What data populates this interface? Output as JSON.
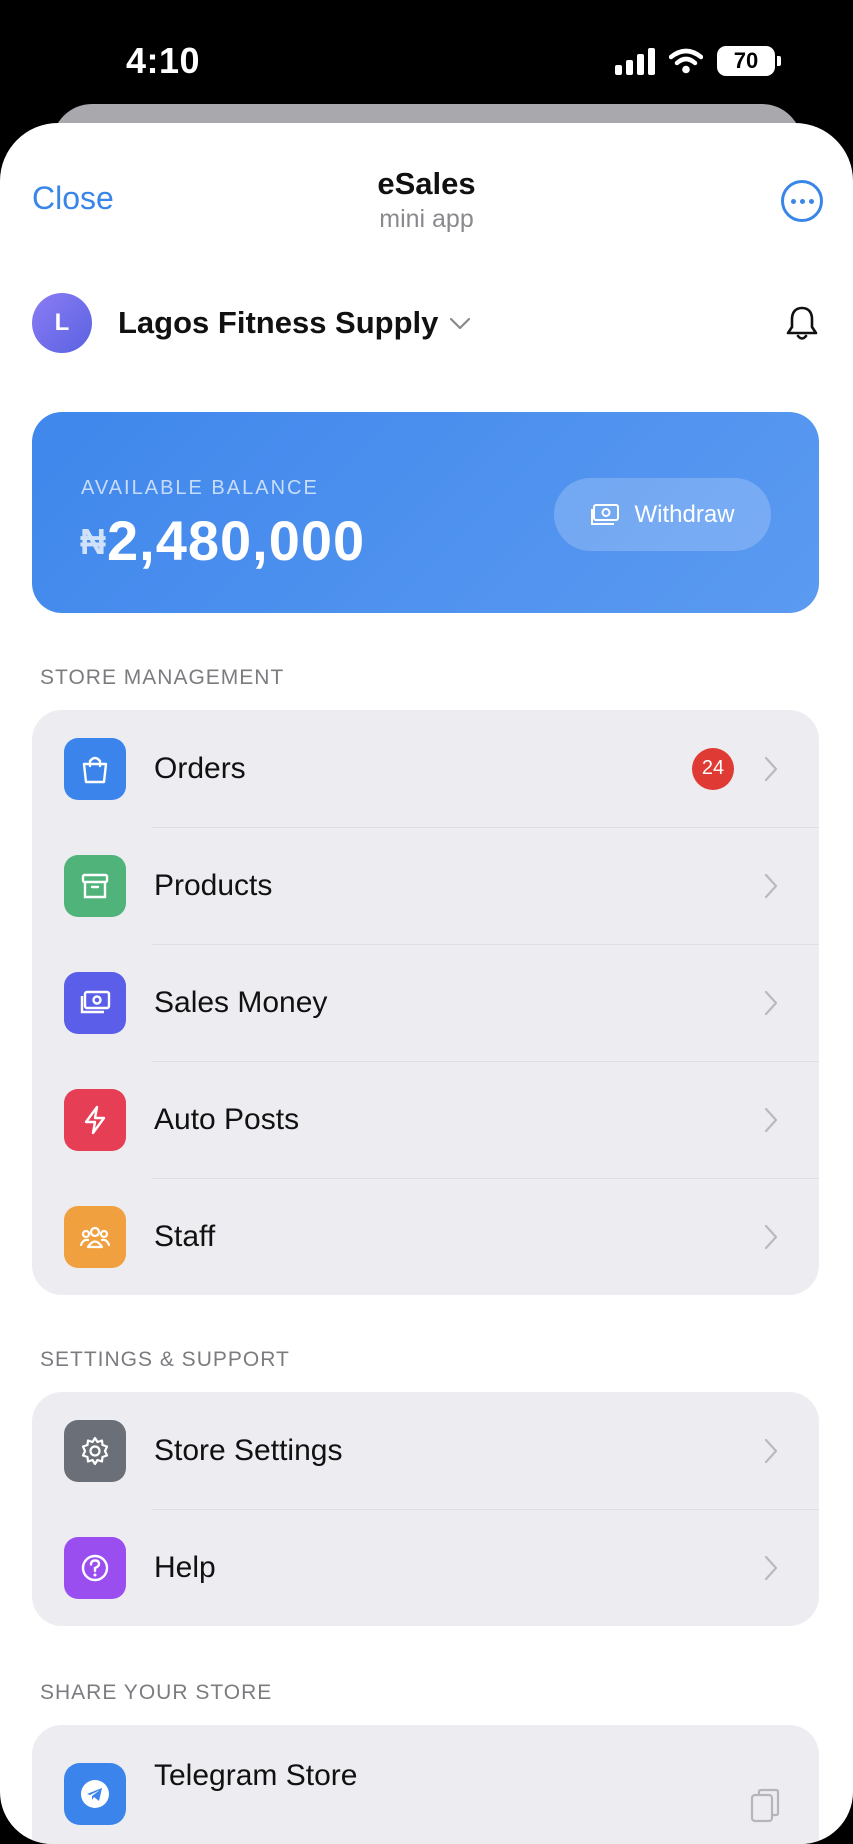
{
  "status_bar": {
    "time": "4:10",
    "battery": "70"
  },
  "header": {
    "close_label": "Close",
    "title": "eSales",
    "subtitle": "mini app"
  },
  "store": {
    "avatar_initial": "L",
    "name": "Lagos Fitness Supply"
  },
  "balance": {
    "label": "AVAILABLE BALANCE",
    "currency": "₦",
    "amount": "2,480,000",
    "withdraw_label": "Withdraw"
  },
  "sections": {
    "store_management": {
      "title": "STORE MANAGEMENT",
      "items": [
        {
          "label": "Orders",
          "icon": "bag-icon",
          "color": "#3a84ec",
          "badge": "24"
        },
        {
          "label": "Products",
          "icon": "archive-box-icon",
          "color": "#4fb37a"
        },
        {
          "label": "Sales Money",
          "icon": "money-icon",
          "color": "#5b5ee8"
        },
        {
          "label": "Auto Posts",
          "icon": "lightning-icon",
          "color": "#e53e55"
        },
        {
          "label": "Staff",
          "icon": "people-icon",
          "color": "#f0a03e"
        }
      ]
    },
    "settings_support": {
      "title": "SETTINGS & SUPPORT",
      "items": [
        {
          "label": "Store Settings",
          "icon": "gear-icon",
          "color": "#6b6f78"
        },
        {
          "label": "Help",
          "icon": "question-icon",
          "color": "#9b4ef0"
        }
      ]
    },
    "share_store": {
      "title": "SHARE YOUR STORE",
      "items": [
        {
          "label": "Telegram Store",
          "icon": "telegram-icon",
          "color": "#3a84ec"
        }
      ]
    }
  }
}
